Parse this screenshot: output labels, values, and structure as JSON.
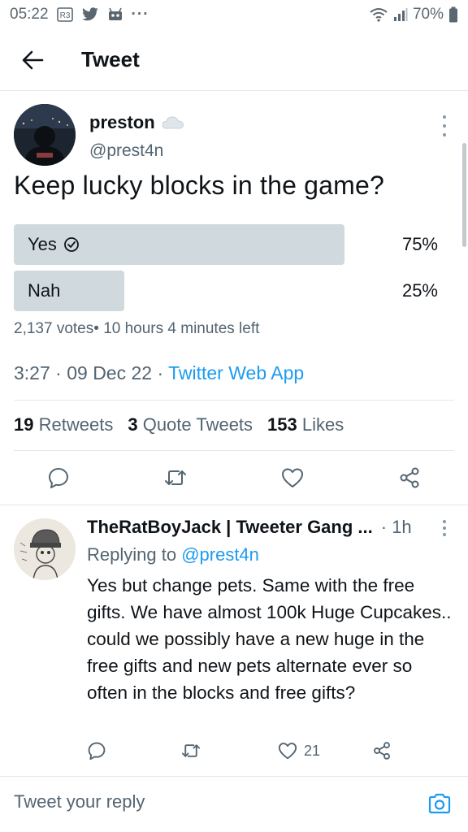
{
  "status_bar": {
    "time": "05:22",
    "battery": "70%",
    "more": "···"
  },
  "header": {
    "title": "Tweet"
  },
  "tweet": {
    "author_name": "preston",
    "author_handle": "@prest4n",
    "text": "Keep lucky blocks in the game?",
    "poll": {
      "options": [
        {
          "label": "Yes",
          "percent": "75%",
          "fraction": 0.75,
          "winner": true
        },
        {
          "label": "Nah",
          "percent": "25%",
          "fraction": 0.25,
          "winner": false
        }
      ],
      "votes": "2,137 votes",
      "separator": "• ",
      "time_left": "10 hours 4 minutes left"
    },
    "time": "3:27",
    "date": "09 Dec 22",
    "dot": " · ",
    "source": "Twitter Web App",
    "stats": {
      "retweets_count": "19",
      "retweets_label": "Retweets",
      "quotes_count": "3",
      "quotes_label": "Quote Tweets",
      "likes_count": "153",
      "likes_label": "Likes"
    }
  },
  "reply": {
    "author_name": "TheRatBoyJack | Tweeter Gang ...",
    "time": "· 1h",
    "replying_prefix": "Replying to ",
    "replying_to": "@prest4n",
    "text": "Yes but change pets. Same with the free gifts. We have almost 100k Huge Cupcakes.. could we possibly have a new huge in the free gifts and new pets alternate ever so often in the blocks and free gifts?",
    "likes": "21"
  },
  "compose": {
    "placeholder": "Tweet your reply"
  },
  "colors": {
    "accent": "#1d9bf0",
    "secondary_text": "#536471",
    "poll_bar": "#cfd9de"
  }
}
